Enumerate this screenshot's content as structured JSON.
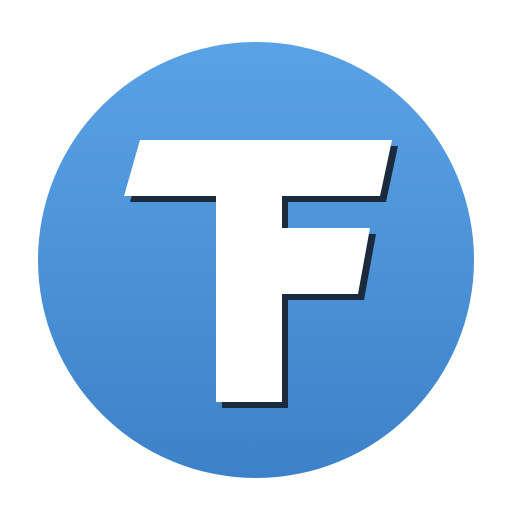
{
  "icon": {
    "name": "tf-logo-icon",
    "letters": "TF",
    "colors": {
      "background": "#ffffff",
      "circle_top": "#5aa2e6",
      "circle_bottom": "#3d82c8",
      "glyph": "#ffffff",
      "glyph_shadow": "#1b2a3d"
    }
  }
}
